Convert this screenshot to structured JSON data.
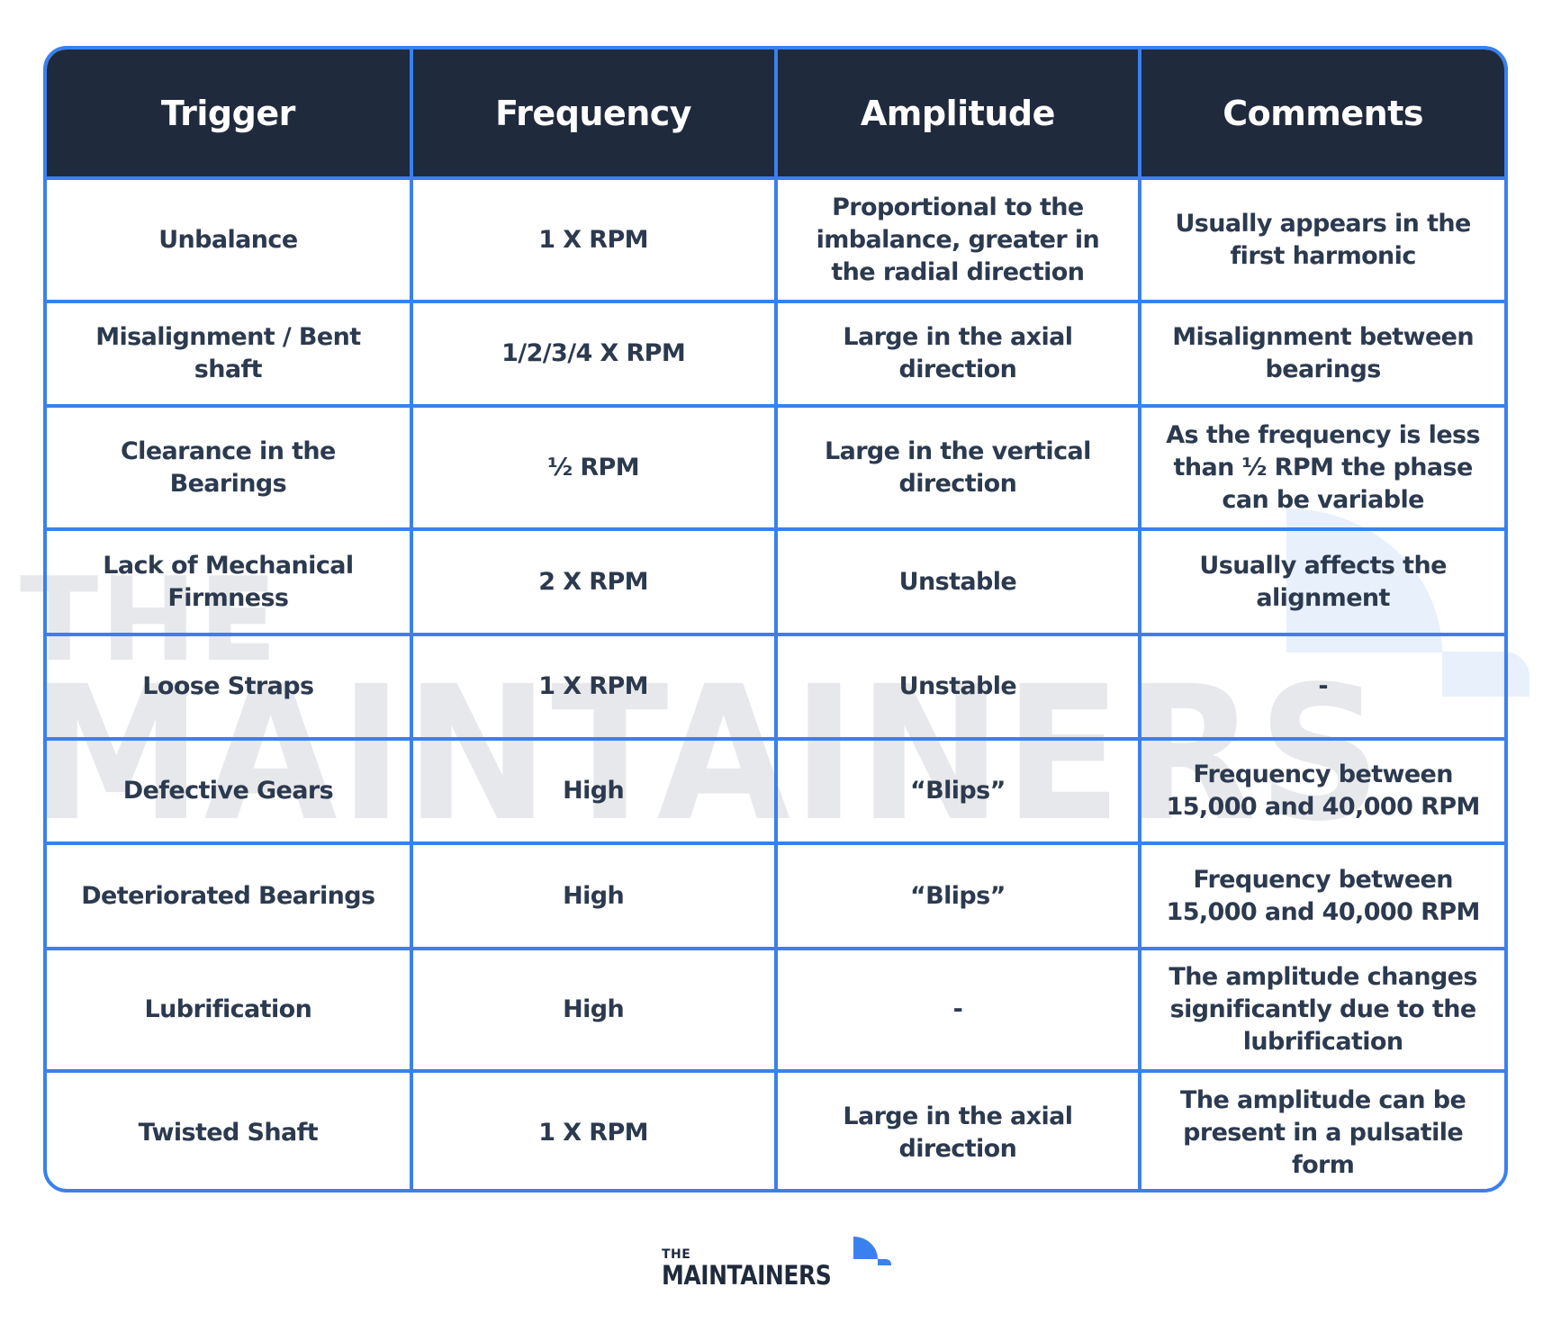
{
  "watermark": {
    "line1": "THE",
    "line2": "MAINTAINERS"
  },
  "table": {
    "headers": [
      "Trigger",
      "Frequency",
      "Amplitude",
      "Comments"
    ],
    "rows": [
      [
        "Unbalance",
        "1 X RPM",
        "Proportional to the imbalance, greater in the radial direction",
        "Usually appears in the first harmonic"
      ],
      [
        "Misalignment / Bent shaft",
        "1/2/3/4 X RPM",
        "Large in the axial direction",
        "Misalignment between bearings"
      ],
      [
        "Clearance in the Bearings",
        "½ RPM",
        "Large in the vertical direction",
        "As the frequency is less than ½ RPM the phase can be variable"
      ],
      [
        "Lack of Mechanical Firmness",
        "2 X RPM",
        "Unstable",
        "Usually affects the alignment"
      ],
      [
        "Loose Straps",
        "1 X RPM",
        "Unstable",
        "-"
      ],
      [
        "Defective Gears",
        "High",
        "“Blips”",
        "Frequency between 15,000 and 40,000 RPM"
      ],
      [
        "Deteriorated Bearings",
        "High",
        "“Blips”",
        "Frequency between 15,000 and 40,000 RPM"
      ],
      [
        "Lubrification",
        "High",
        "-",
        "The amplitude changes significantly due to the lubrification"
      ],
      [
        "Twisted Shaft",
        "1 X RPM",
        "Large in the axial direction",
        "The amplitude can be present in a pulsatile form"
      ]
    ]
  },
  "footer": {
    "logo_line1": "THE",
    "logo_line2": "MAINTAINERS"
  },
  "colors": {
    "accent_blue": "#3a80ef",
    "header_bg": "#1f2a3c",
    "body_text": "#2c3a4f",
    "watermark_gray": "#e7e8eb",
    "watermark_blue": "#e8f0fc"
  }
}
